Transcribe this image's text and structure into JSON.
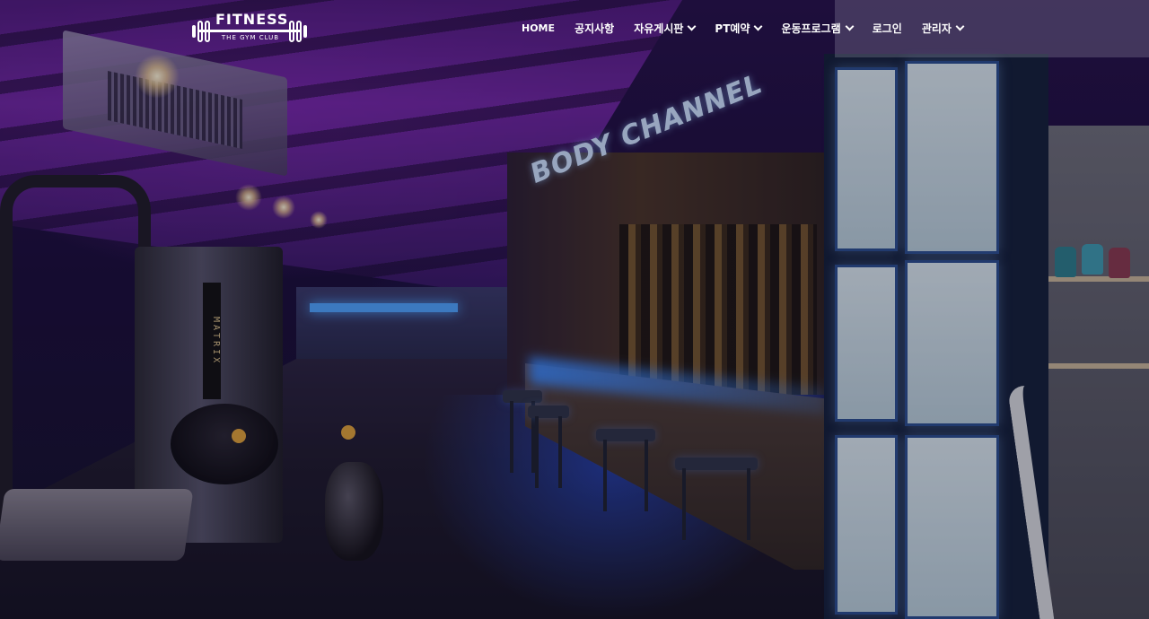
{
  "logo": {
    "title": "FITNESS",
    "subtitle": "THE GYM CLUB"
  },
  "nav": {
    "items": [
      {
        "label": "HOME",
        "has_dropdown": false
      },
      {
        "label": "공지사항",
        "has_dropdown": false
      },
      {
        "label": "자유게시판",
        "has_dropdown": true
      },
      {
        "label": "PT예약",
        "has_dropdown": true
      },
      {
        "label": "운동프로그램",
        "has_dropdown": true
      },
      {
        "label": "로그인",
        "has_dropdown": false
      },
      {
        "label": "관리자",
        "has_dropdown": true
      }
    ]
  },
  "hero": {
    "sign_text": "BODY CHANNEL",
    "machine_text": "MATRIX"
  },
  "colors": {
    "accent_purple": "#7b2bb0",
    "accent_blue": "#4fa6ff",
    "nav_text": "#ffffff"
  }
}
